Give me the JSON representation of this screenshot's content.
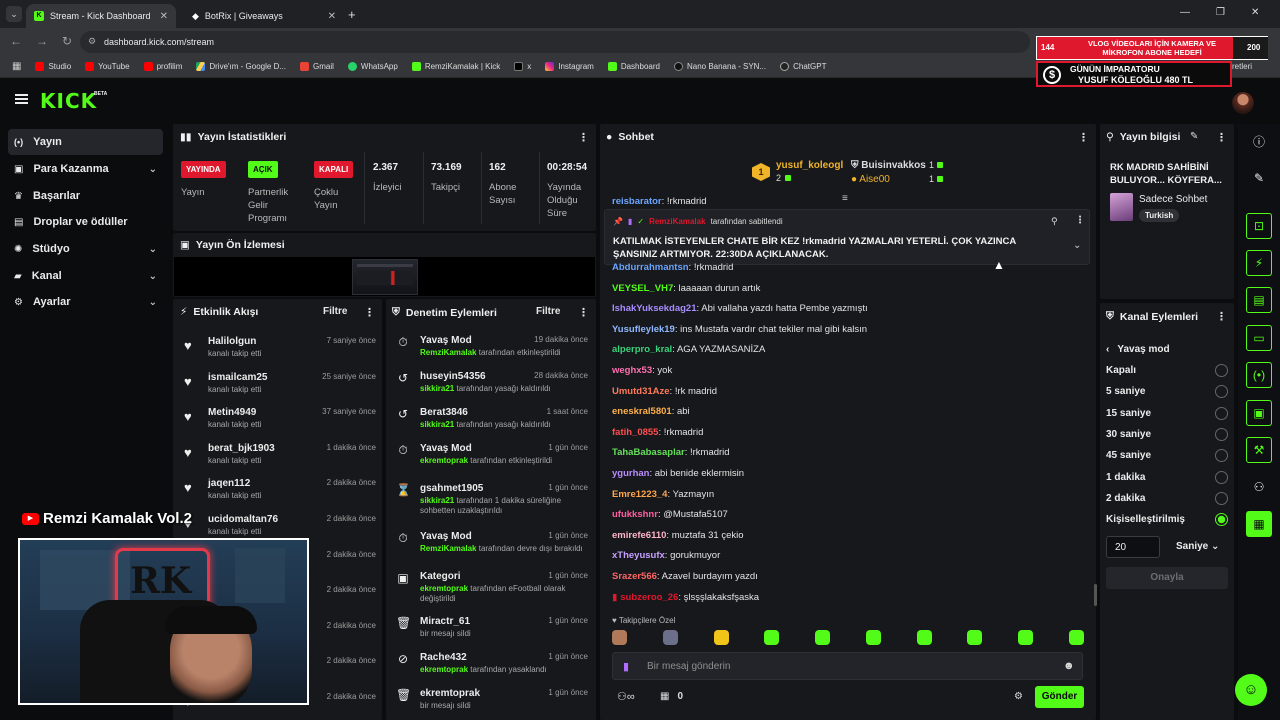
{
  "browser": {
    "tabs": [
      {
        "title": "Stream - Kick Dashboard"
      },
      {
        "title": "BotRix | Giveaways"
      }
    ],
    "url": "dashboard.kick.com/stream",
    "bookmarks": [
      "Studio",
      "YouTube",
      "profilim",
      "Drive'ım - Google D...",
      "Gmail",
      "WhatsApp",
      "RemziKamalak | Kick",
      "x",
      "Instagram",
      "Dashboard",
      "Nano Banana - SYN...",
      "ChatGPT"
    ],
    "bookmarks_right": "er İşaretleri"
  },
  "overlay": {
    "goal_count": "144",
    "goal_text": "VLOG VİDEOLARI İÇİN KAMERA VE MİKROFON ABONE HEDEFİ",
    "goal_target": "200",
    "emperor_title": "GÜNÜN İMPARATORU",
    "emperor_text": "YUSUF KÖLEOĞLU 480 TL",
    "streamer_tag": "Remzi Kamalak Vol.2"
  },
  "logo": "KICK",
  "logo_beta": "BETA",
  "sidebar": {
    "items": [
      {
        "label": "Yayın",
        "icon": "broadcast-icon",
        "selected": true
      },
      {
        "label": "Para Kazanma",
        "icon": "wallet-icon",
        "chevron": true
      },
      {
        "label": "Başarılar",
        "icon": "trophy-icon"
      },
      {
        "label": "Droplar ve ödüller",
        "icon": "gift-icon"
      },
      {
        "label": "Stüdyo",
        "icon": "studio-icon",
        "chevron": true
      },
      {
        "label": "Kanal",
        "icon": "channel-icon",
        "chevron": true
      },
      {
        "label": "Ayarlar",
        "icon": "gear-icon",
        "chevron": true
      }
    ]
  },
  "stats": {
    "title": "Yayın İstatistikleri",
    "badges": [
      {
        "badge": "YAYINDA",
        "label": "Yayın",
        "color": "#e0182d"
      },
      {
        "badge": "AÇIK",
        "label": "Partnerlik Gelir Programı",
        "color": "#53fc18"
      },
      {
        "badge": "KAPALI",
        "label": "Çoklu Yayın",
        "color": "#e0182d"
      }
    ],
    "numbers": [
      {
        "value": "2.367",
        "label": "İzleyici"
      },
      {
        "value": "73.169",
        "label": "Takipçi"
      },
      {
        "value": "162",
        "label": "Abone Sayısı"
      },
      {
        "value": "00:28:54",
        "label": "Yayında Olduğu Süre"
      }
    ]
  },
  "preview": {
    "title": "Yayın Ön İzlemesi"
  },
  "activity": {
    "title": "Etkinlik Akışı",
    "filter": "Filtre",
    "items": [
      {
        "name": "Halilolgun",
        "sub": "kanalı takip etti",
        "time": "7 saniye önce"
      },
      {
        "name": "ismailcam25",
        "sub": "kanalı takip etti",
        "time": "25 saniye önce"
      },
      {
        "name": "Metin4949",
        "sub": "kanalı takip etti",
        "time": "37 saniye önce"
      },
      {
        "name": "berat_bjk1903",
        "sub": "kanalı takip etti",
        "time": "1 dakika önce"
      },
      {
        "name": "jaqen112",
        "sub": "kanalı takip etti",
        "time": "2 dakika önce"
      },
      {
        "name": "ucidomaltan76",
        "sub": "kanalı takip etti",
        "time": "2 dakika önce"
      },
      {
        "name": "",
        "sub": "",
        "time": "2 dakika önce"
      },
      {
        "name": "",
        "sub": "",
        "time": "2 dakika önce"
      },
      {
        "name": "",
        "sub": "",
        "time": "2 dakika önce"
      },
      {
        "name": "",
        "sub": "",
        "time": "2 dakika önce"
      },
      {
        "name": "",
        "sub": "kanalı takip etti",
        "time": "2 dakika önce"
      }
    ]
  },
  "moderation": {
    "title": "Denetim Eylemleri",
    "filter": "Filtre",
    "items": [
      {
        "icon": "slow-mode-icon",
        "title": "Yavaş Mod",
        "time": "19 dakika önce",
        "actor": "RemziKamalak",
        "text": "tarafından etkinleştirildi"
      },
      {
        "icon": "unban-icon",
        "title": "huseyin54356",
        "time": "28 dakika önce",
        "actor": "sikkira21",
        "text": "tarafından yasağı kaldırıldı"
      },
      {
        "icon": "unban-icon",
        "title": "Berat3846",
        "time": "1 saat önce",
        "actor": "sikkira21",
        "text": "tarafından yasağı kaldırıldı"
      },
      {
        "icon": "slow-mode-icon",
        "title": "Yavaş Mod",
        "time": "1 gün önce",
        "actor": "ekremtoprak",
        "text": "tarafından etkinleştirildi"
      },
      {
        "icon": "timeout-icon",
        "title": "gsahmet1905",
        "time": "1 gün önce",
        "actor": "sikkira21",
        "text": "tarafından 1 dakika süreliğine sohbetten uzaklaştırıldı"
      },
      {
        "icon": "slow-mode-icon",
        "title": "Yavaş Mod",
        "time": "1 gün önce",
        "actor": "RemziKamalak",
        "text": "tarafından devre dışı bırakıldı"
      },
      {
        "icon": "category-icon",
        "title": "Kategori",
        "time": "1 gün önce",
        "actor": "ekremtoprak",
        "text": "tarafından eFootball olarak değiştirildi"
      },
      {
        "icon": "trash-icon",
        "title": "Miractr_61",
        "time": "1 gün önce",
        "actor": "",
        "text": "bir mesajı sildi"
      },
      {
        "icon": "ban-icon",
        "title": "Rache432",
        "time": "1 gün önce",
        "actor": "ekremtoprak",
        "text": "tarafından yasaklandı"
      },
      {
        "icon": "trash-icon",
        "title": "ekremtoprak",
        "time": "1 gün önce",
        "actor": "",
        "text": "bir mesajı sildi"
      }
    ]
  },
  "chat": {
    "title": "Sohbet",
    "leaderboard": [
      {
        "name": "yusuf_koleogl",
        "count": "2",
        "rank": "1"
      },
      {
        "name": "Buisinvakkos",
        "count": "1"
      },
      {
        "name": "Aise00",
        "count": "1"
      }
    ],
    "pinned_by": "RemziKamalak",
    "pinned_suffix": "tarafından sabitlendi",
    "pinned_text": "KATILMAK İSTEYENLER CHATE BİR KEZ !rkmadrid YAZMALARI YETERLİ. ÇOK YAZINCA ŞANSINIZ ARTMIYOR. 22:30DA AÇIKLANACAK.",
    "top_partial": {
      "user": "reisbarator",
      "text": "!rkmadrid",
      "color": "#6aa6ff"
    },
    "messages": [
      {
        "user": "Abdurrahmantsn",
        "text": "!rkmadrid",
        "color": "#6aa6ff"
      },
      {
        "user": "VEYSEL_VH7",
        "text": "laaaaan durun artık",
        "color": "#53fc18"
      },
      {
        "user": "IshakYuksekdag21",
        "text": "Abi vallaha yazdı hatta Pembe yazmıştı",
        "color": "#a88cff"
      },
      {
        "user": "Yusufleylek19",
        "text": "ins Mustafa vardır chat tekiler mal gibi kalsın",
        "color": "#8fb8ff"
      },
      {
        "user": "alperpro_kral",
        "text": "AGA YAZMASANİZA",
        "color": "#3ad27a"
      },
      {
        "user": "weghx53",
        "text": "yok",
        "color": "#ff6fb1"
      },
      {
        "user": "Umutd31Aze",
        "text": "!rk madrid",
        "color": "#ff7b5a"
      },
      {
        "user": "eneskral5801",
        "text": "abi",
        "color": "#ffb14a"
      },
      {
        "user": "fatih_0855",
        "text": "!rkmadrid",
        "color": "#ff4f4f"
      },
      {
        "user": "TahaBabasaplar",
        "text": "!rkmadrid",
        "color": "#65e05a"
      },
      {
        "user": "ygurhan",
        "text": "abi benide eklermisin",
        "color": "#b98cff"
      },
      {
        "user": "Emre1223_4",
        "text": "Yazmayın",
        "color": "#ffa64a"
      },
      {
        "user": "ufukkshnr",
        "text": "@Mustafa5107",
        "color": "#ff5fa0"
      },
      {
        "user": "emirefe6110",
        "text": "muztafa 31 çekio",
        "color": "#ffb3c7"
      },
      {
        "user": "xTheyusufx",
        "text": "gorukmuyor",
        "color": "#c7a0ff"
      },
      {
        "user": "Srazer566",
        "text": "Azavel burdayım yazdı",
        "color": "#ff6464"
      },
      {
        "user": "subzeroo_26",
        "text": "şlsşşlakaksfşaska",
        "color": "#e0182d"
      }
    ],
    "emote_label": "Takipçilere Özel",
    "input_placeholder": "Bir mesaj gönderin",
    "points": "0",
    "send": "Gönder"
  },
  "stream_info": {
    "title": "Yayın bilgisi",
    "stream_title": "RK MADRID SAHİBİNİ BULUYOR... KÖYFERA...",
    "category": "Sadece Sohbet",
    "tag": "Turkish"
  },
  "channel_actions": {
    "title": "Kanal Eylemleri",
    "back_label": "Yavaş mod",
    "options": [
      {
        "label": "Kapalı",
        "selected": false
      },
      {
        "label": "5 saniye",
        "selected": false
      },
      {
        "label": "15 saniye",
        "selected": false
      },
      {
        "label": "30 saniye",
        "selected": false
      },
      {
        "label": "45 saniye",
        "selected": false
      },
      {
        "label": "1 dakika",
        "selected": false
      },
      {
        "label": "2 dakika",
        "selected": false
      },
      {
        "label": "Kişiselleştirilmiş",
        "selected": true
      }
    ],
    "custom_value": "20",
    "unit": "Saniye",
    "confirm": "Onayla"
  },
  "colors": {
    "brand": "#53fc18",
    "live": "#e0182d",
    "panel": "#17181c"
  }
}
